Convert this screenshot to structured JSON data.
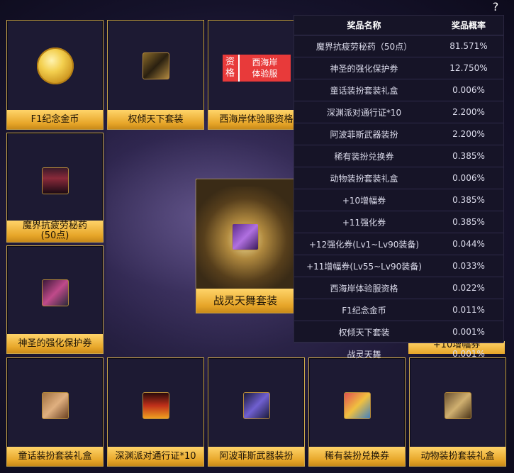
{
  "help_label": "?",
  "cards": {
    "f1_coin": "F1纪念金币",
    "power_set": "权倾天下套装",
    "west_coast": "西海岸体验服资格",
    "badge_a": [
      "资",
      "格"
    ],
    "badge_b": [
      "西海岸",
      "体验服"
    ],
    "potion": "魔界抗疲劳秘药\n(50点)",
    "potion_l1": "魔界抗疲劳秘药",
    "potion_l2": "(50点)",
    "holy_protect": "神圣的强化保护券",
    "spirit_set": "战灵天舞套装",
    "amp_partial": "+10增幅券",
    "fairy_box": "童话装扮套装礼盒",
    "abyss_pass": "深渊派对通行证*10",
    "apophis_weapon": "阿波菲斯武器装扮",
    "rare_voucher": "稀有装扮兑换券",
    "animal_box": "动物装扮套装礼盒"
  },
  "prob_table": {
    "col_name": "奖品名称",
    "col_rate": "奖品概率",
    "rows": [
      {
        "name": "魔界抗疲劳秘药（50点）",
        "rate": "81.571%"
      },
      {
        "name": "神圣的强化保护券",
        "rate": "12.750%"
      },
      {
        "name": "童话装扮套装礼盒",
        "rate": "0.006%"
      },
      {
        "name": "深渊派对通行证*10",
        "rate": "2.200%"
      },
      {
        "name": "阿波菲斯武器装扮",
        "rate": "2.200%"
      },
      {
        "name": "稀有装扮兑换券",
        "rate": "0.385%"
      },
      {
        "name": "动物装扮套装礼盒",
        "rate": "0.006%"
      },
      {
        "name": "+10增幅券",
        "rate": "0.385%"
      },
      {
        "name": "+11强化券",
        "rate": "0.385%"
      },
      {
        "name": "+12强化券(Lv1~Lv90装备)",
        "rate": "0.044%"
      },
      {
        "name": "+11增幅券(Lv55~Lv90装备)",
        "rate": "0.033%"
      },
      {
        "name": "西海岸体验服资格",
        "rate": "0.022%"
      },
      {
        "name": "F1纪念金币",
        "rate": "0.011%"
      },
      {
        "name": "权倾天下套装",
        "rate": "0.001%"
      },
      {
        "name": "战灵天舞",
        "rate": "0.001%"
      }
    ]
  },
  "colors": {
    "label_gold": "#e7a629",
    "card_bg": "#1d1a33",
    "table_bg": "#161427",
    "badge_red": "#e83a3a"
  }
}
